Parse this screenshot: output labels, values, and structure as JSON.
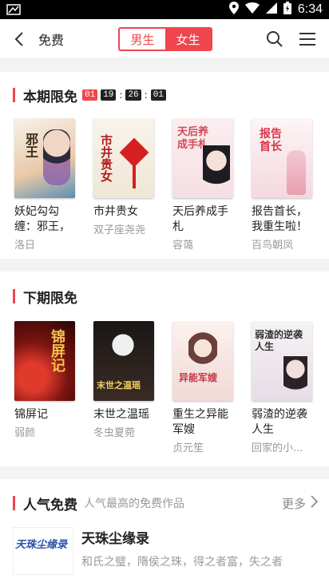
{
  "status": {
    "time": "6:34"
  },
  "header": {
    "title": "免费",
    "tabs": [
      "男生",
      "女生"
    ],
    "active_tab": "女生"
  },
  "current": {
    "title": "本期限免",
    "timer": [
      "01",
      "19",
      "26",
      "01"
    ],
    "books": [
      {
        "name": "妖妃勾勾缠：邪王，",
        "author": "洛日",
        "cover_text": "邪王"
      },
      {
        "name": "市井贵女",
        "author": "双子座尧尧",
        "cover_text": "市井贵女"
      },
      {
        "name": "天后养成手札",
        "author": "容蔼",
        "cover_text": "天后养成手札"
      },
      {
        "name": "报告首长，我重生啦！",
        "author": "百鸟朝凤",
        "cover_text": "报告首长"
      }
    ]
  },
  "next": {
    "title": "下期限免",
    "books": [
      {
        "name": "锦屏记",
        "author": "弱颜",
        "cover_text": "锦屏记"
      },
      {
        "name": "末世之温瑶",
        "author": "冬虫夏菀",
        "cover_text": "末世之温瑶"
      },
      {
        "name": "重生之异能军嫂",
        "author": "贞元笙",
        "cover_text": "异能军嫂"
      },
      {
        "name": "弱渣的逆袭人生",
        "author": "回家的小...",
        "cover_text": "弱渣的逆袭人生"
      }
    ]
  },
  "popular": {
    "title": "人气免费",
    "subtitle": "人气最高的免费作品",
    "more": "更多",
    "item": {
      "name": "天珠尘缘录",
      "desc": "和氏之璧，隋侯之珠，得之者富，失之者",
      "cover_text": "天珠尘缘录"
    }
  }
}
